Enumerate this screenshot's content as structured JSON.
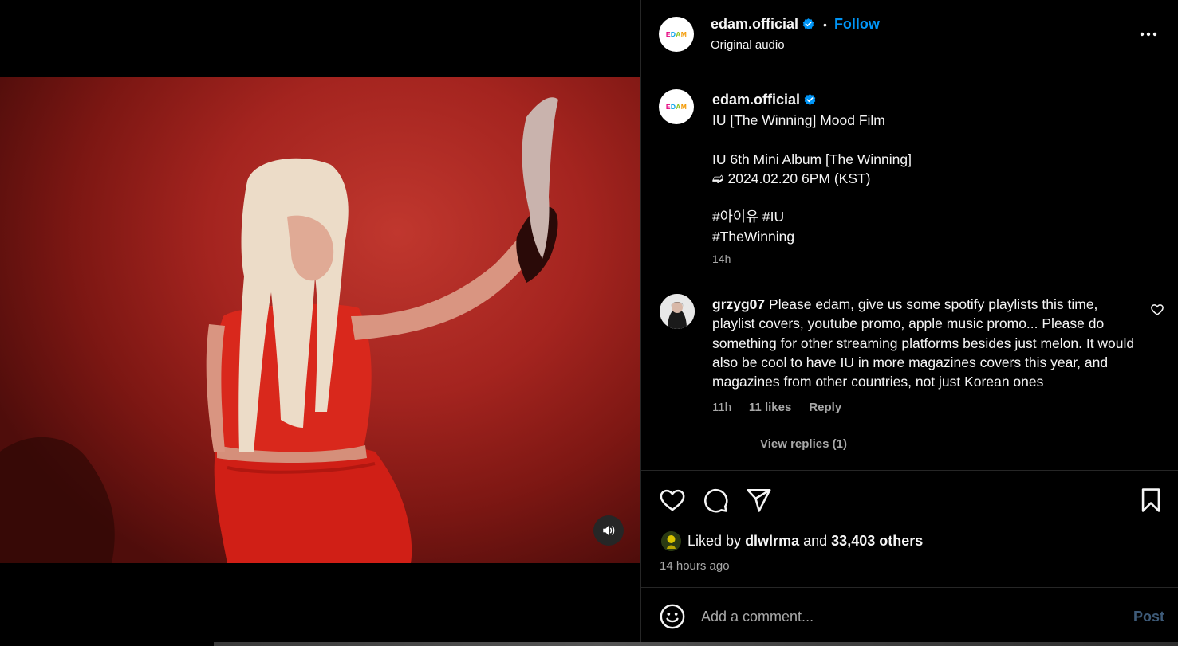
{
  "post": {
    "username": "edam.official",
    "follow_label": "Follow",
    "dot": "•",
    "audio_label": "Original audio",
    "avatar_text": [
      "E",
      "D",
      "A",
      "M"
    ],
    "verified_icon": "verified-badge-icon",
    "more_icon": "more-horizontal-icon",
    "caption_lines": "IU [The Winning] Mood Film\n\nIU 6th Mini Album [The Winning]\n➫ 2024.02.20 6PM (KST)\n\n#아이유 #IU\n#TheWinning",
    "caption_time": "14h"
  },
  "comment": {
    "username": "grzyg07",
    "text": "Please edam, give us some spotify playlists this time, playlist covers, youtube promo, apple music promo... Please do something for other streaming platforms besides just melon. It would also be cool to have IU in more magazines covers this year, and magazines from other countries, not just Korean ones",
    "time": "11h",
    "likes": "11 likes",
    "reply_label": "Reply",
    "view_replies": "View replies (1)"
  },
  "engagement": {
    "liked_by_prefix": "Liked by",
    "liked_by_user": "dlwlrma",
    "and": "and",
    "others": "33,403 others",
    "posted_ago": "14 hours ago"
  },
  "composer": {
    "placeholder": "Add a comment...",
    "post_label": "Post"
  },
  "colors": {
    "accent": "#0095f6",
    "background": "#000000",
    "muted_text": "#a8a8a8",
    "post_disabled": "#3e5b79"
  }
}
